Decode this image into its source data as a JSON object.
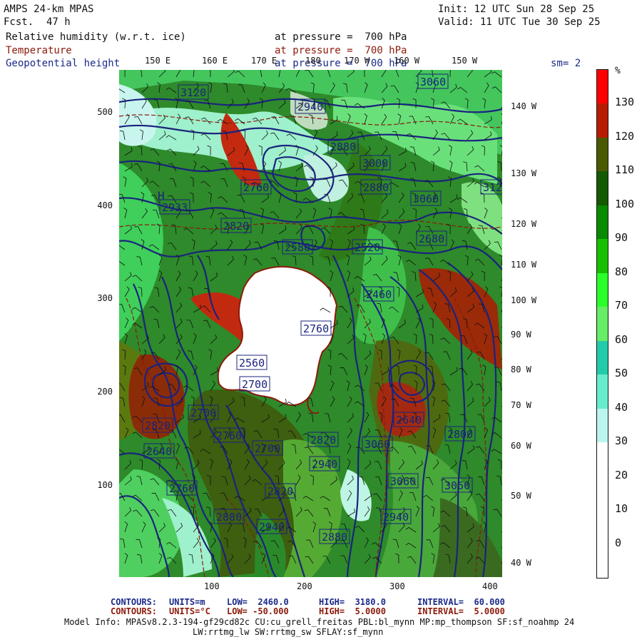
{
  "header": {
    "model": "AMPS 24-km MPAS",
    "fcst_label": "Fcst.",
    "fcst_value": "47 h",
    "init": "Init: 12 UTC Sun 28 Sep 25",
    "valid": "Valid: 11 UTC Tue 30 Sep 25",
    "fields": [
      {
        "name": "Relative humidity (w.r.t. ice)",
        "pressure": "at pressure =  700 hPa",
        "color": "#111111"
      },
      {
        "name": "Temperature",
        "pressure": "at pressure =  700 hPa",
        "color": "#8b1a0a"
      },
      {
        "name": "Geopotential height",
        "pressure": "at pressure =  700 hPa",
        "color": "#1a2a8a"
      }
    ],
    "smoothing": "sm= 2"
  },
  "axes": {
    "y_ticks": [
      "500",
      "400",
      "300",
      "200",
      "100"
    ],
    "x_ticks": [
      "100",
      "200",
      "300",
      "400"
    ],
    "top_longitudes": [
      "150 E",
      "160 E",
      "170 E",
      "180",
      "170 W",
      "160 W",
      "150 W"
    ],
    "right_longitudes": [
      "140 W",
      "130 W",
      "120 W",
      "110 W",
      "100 W",
      "90 W",
      "80 W",
      "70 W",
      "60 W",
      "50 W",
      "40 W"
    ]
  },
  "map": {
    "contour_labels_height": [
      "3120",
      "3060",
      "2940",
      "2880",
      "3000",
      "2760",
      "2880",
      "3060",
      "3120",
      "2933",
      "2820",
      "2580",
      "2520",
      "2680",
      "2460",
      "2760",
      "2560",
      "2700",
      "2700",
      "2820",
      "2760",
      "2640",
      "2700",
      "3060",
      "2820",
      "2940",
      "2640",
      "2800",
      "2760",
      "2820",
      "3060",
      "3060",
      "2880",
      "2940",
      "2940",
      "2880"
    ],
    "high_marker": "H"
  },
  "colorbar": {
    "unit": "%",
    "labels": [
      "130",
      "120",
      "110",
      "100",
      "90",
      "80",
      "70",
      "60",
      "50",
      "40",
      "30",
      "20",
      "10",
      "0"
    ],
    "colors": [
      "#ff0000",
      "#b81c00",
      "#4a5a00",
      "#145a00",
      "#0a8a00",
      "#16c000",
      "#2aff2a",
      "#66ee66",
      "#22ccaa",
      "#66eecc",
      "#bbf5ee",
      "#ffffff",
      "#ffffff",
      "#ffffff",
      "#ffffff"
    ]
  },
  "footer": {
    "line1_label": "CONTOURS:",
    "line1_units": "UNITS=m",
    "line1_low": "LOW=  2460.0",
    "line1_high": "HIGH=  3180.0",
    "line1_interval": "INTERVAL=  60.000",
    "line2_label": "CONTOURS:",
    "line2_units": "UNITS=°C",
    "line2_low": "LOW= -50.000",
    "line2_high": "HIGH=  5.0000",
    "line2_interval": "INTERVAL=  5.0000",
    "model_info_1": "Model Info: MPASv8.2.3-194-gf29cd82c CU:cu_grell_freitas PBL:bl_mynn MP:mp_thompson SF:sf_noahmp 24",
    "model_info_2": "LW:rrtmg_lw SW:rrtmg_sw SFLAY:sf_mynn"
  }
}
